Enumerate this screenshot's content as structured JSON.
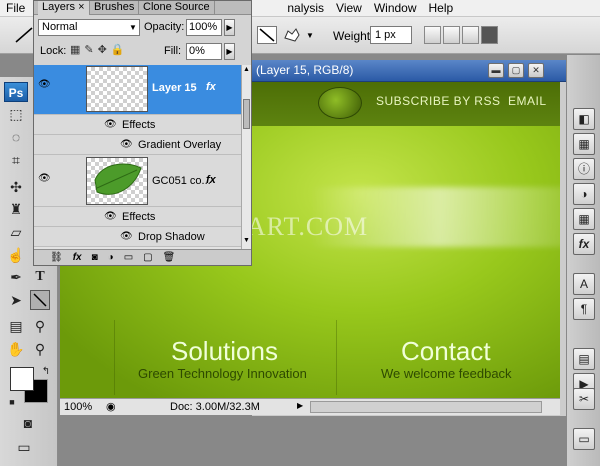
{
  "menu": {
    "file": "File",
    "analysis": "nalysis",
    "view": "View",
    "window": "Window",
    "help": "Help"
  },
  "options_bar": {
    "weight_label": "Weight:",
    "weight_value": "1 px"
  },
  "toolbox": {
    "logo": "Ps"
  },
  "layers_panel": {
    "tabs": [
      "Layers ×",
      "Brushes",
      "Clone Source"
    ],
    "blend_mode": "Normal",
    "opacity_label": "Opacity:",
    "opacity_value": "100%",
    "lock_label": "Lock:",
    "fill_label": "Fill:",
    "fill_value": "0%",
    "layers": [
      {
        "name": "Layer 15",
        "fx": "fx"
      },
      {
        "effects_label": "Effects",
        "effect": "Gradient Overlay"
      },
      {
        "name": "GC051 co...",
        "fx": "fx"
      },
      {
        "effects_label": "Effects",
        "effect": "Drop Shadow"
      }
    ]
  },
  "document": {
    "title": "(Layer 15, RGB/8)",
    "header_links": {
      "subscribe": "SUBSCRIBE BY RSS",
      "email": "EMAIL"
    },
    "watermark": "ALFOART.COM",
    "sections": [
      {
        "title": "Solutions",
        "subtitle": "Green Technology Innovation"
      },
      {
        "title": "Contact",
        "subtitle": "We welcome feedback"
      }
    ],
    "status": {
      "zoom": "100%",
      "doc_size": "Doc: 3.00M/32.3M"
    }
  },
  "colors": {
    "selection_blue": "#3a8ce0",
    "green_bright": "#c4e44b",
    "green_dark": "#4d6e06"
  }
}
